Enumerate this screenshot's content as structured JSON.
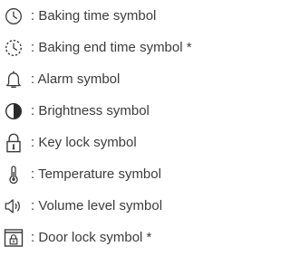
{
  "legend": {
    "items": [
      {
        "icon": "clock-icon",
        "label": ": Baking time symbol"
      },
      {
        "icon": "dashed-clock-icon",
        "label": ": Baking end time symbol *"
      },
      {
        "icon": "bell-icon",
        "label": ": Alarm symbol"
      },
      {
        "icon": "half-circle-icon",
        "label": ": Brightness symbol"
      },
      {
        "icon": "padlock-icon",
        "label": ": Key lock symbol"
      },
      {
        "icon": "thermometer-icon",
        "label": ": Temperature symbol"
      },
      {
        "icon": "speaker-icon",
        "label": ": Volume level symbol"
      },
      {
        "icon": "door-lock-icon",
        "label": ": Door lock symbol *"
      }
    ]
  }
}
